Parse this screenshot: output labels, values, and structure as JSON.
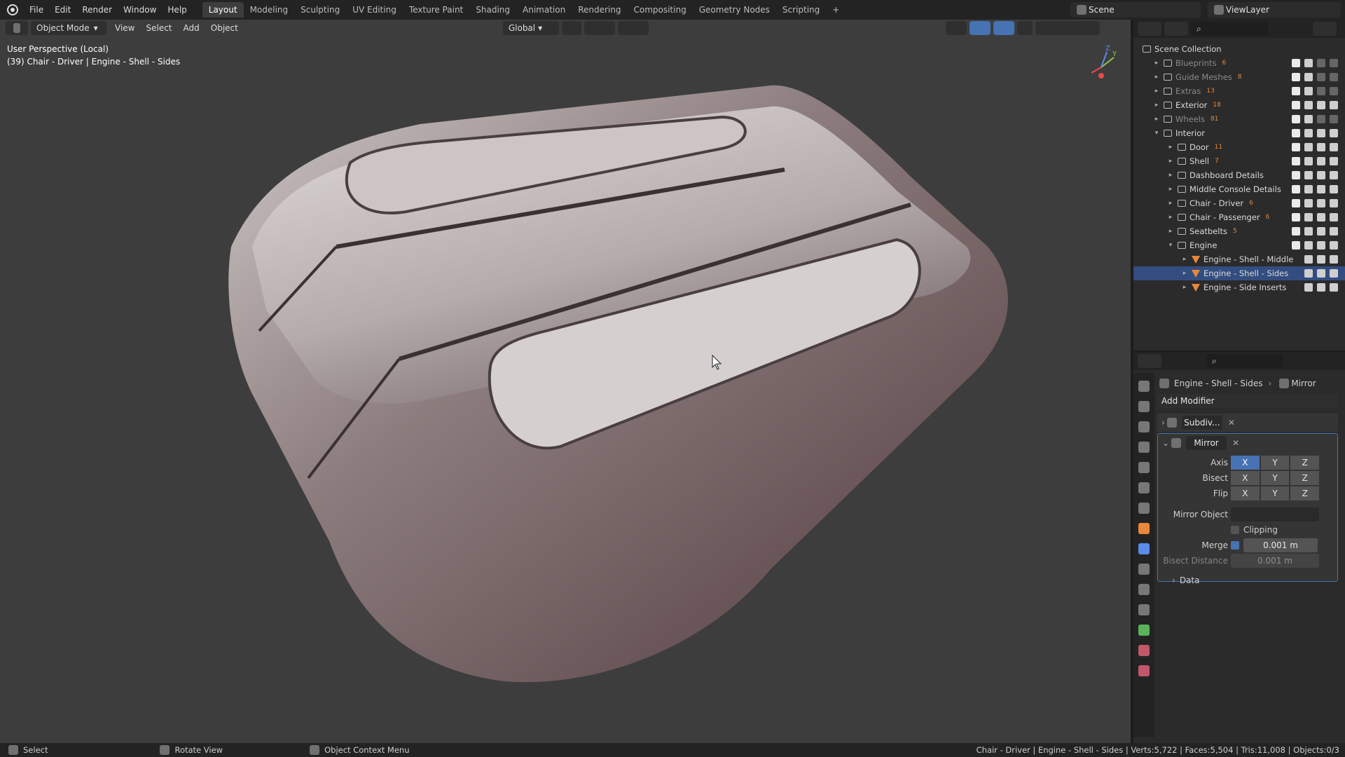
{
  "menu": {
    "file": "File",
    "edit": "Edit",
    "render": "Render",
    "window": "Window",
    "help": "Help"
  },
  "workspaces": [
    "Layout",
    "Modeling",
    "Sculpting",
    "UV Editing",
    "Texture Paint",
    "Shading",
    "Animation",
    "Rendering",
    "Compositing",
    "Geometry Nodes",
    "Scripting",
    "+"
  ],
  "top_right": {
    "scene": "Scene",
    "view_layer": "ViewLayer"
  },
  "viewport": {
    "mode": "Object Mode",
    "view": "View",
    "select": "Select",
    "add": "Add",
    "object": "Object",
    "transform": "Global",
    "perspective": "User Perspective (Local)",
    "active": "(39) Chair - Driver | Engine - Shell - Sides",
    "gizmo": {
      "y": "Y",
      "z": "Z"
    }
  },
  "outliner": {
    "root": "Scene Collection",
    "items": [
      {
        "label": "Blueprints",
        "count": "6",
        "dim": true
      },
      {
        "label": "Guide Meshes",
        "count": "8",
        "dim": true
      },
      {
        "label": "Extras",
        "count": "13",
        "dim": true
      },
      {
        "label": "Exterior",
        "count": "18",
        "dim": false
      },
      {
        "label": "Wheels",
        "count": "81",
        "dim": true
      },
      {
        "label": "Interior",
        "count": "",
        "dim": false
      },
      {
        "label": "Door",
        "count": "11",
        "dim": false
      },
      {
        "label": "Shell",
        "count": "7",
        "dim": false
      },
      {
        "label": "Dashboard Details",
        "count": "",
        "dim": false
      },
      {
        "label": "Middle Console Details",
        "count": "",
        "dim": false
      },
      {
        "label": "Chair - Driver",
        "count": "6",
        "dim": false
      },
      {
        "label": "Chair - Passenger",
        "count": "6",
        "dim": false
      },
      {
        "label": "Seatbelts",
        "count": "5",
        "dim": false
      },
      {
        "label": "Engine",
        "count": "",
        "dim": false
      },
      {
        "label": "Engine - Shell - Middle",
        "count": "",
        "dim": false
      },
      {
        "label": "Engine - Shell - Sides",
        "count": "",
        "dim": false
      },
      {
        "label": "Engine - Side Inserts",
        "count": "",
        "dim": false
      }
    ]
  },
  "properties": {
    "breadcrumb_object": "Engine - Shell - Sides",
    "breadcrumb_modifier": "Mirror",
    "add_modifier": "Add Modifier",
    "mod1": "Subdiv...",
    "mod2": "Mirror",
    "axis": "Axis",
    "bisect": "Bisect",
    "flip": "Flip",
    "x": "X",
    "y": "Y",
    "z": "Z",
    "mirror_object": "Mirror Object",
    "clipping": "Clipping",
    "merge": "Merge",
    "merge_value": "0.001 m",
    "bisect_distance": "Bisect Distance",
    "bisect_value": "0.001 m",
    "data": "Data"
  },
  "status": {
    "select": "Select",
    "rotate": "Rotate View",
    "context": "Object Context Menu",
    "stats": "Chair - Driver | Engine - Shell - Sides | Verts:5,722 | Faces:5,504 | Tris:11,008 | Objects:0/3"
  },
  "colors": {
    "accent": "#4772b3",
    "mesh": "#e8883a"
  }
}
